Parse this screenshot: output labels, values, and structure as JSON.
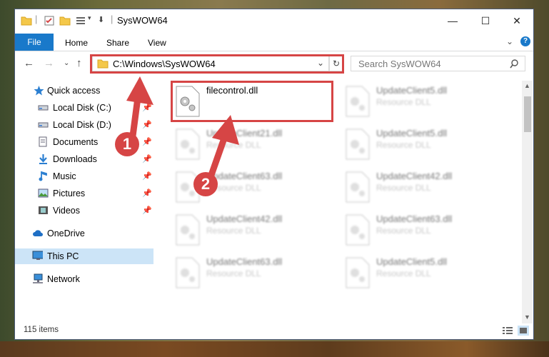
{
  "window": {
    "title": "SysWOW64",
    "minimize": "—",
    "maximize": "☐",
    "close": "✕"
  },
  "ribbon": {
    "file": "File",
    "home": "Home",
    "share": "Share",
    "view": "View",
    "help": "?"
  },
  "address": {
    "path": "C:\\Windows\\SysWOW64",
    "search_placeholder": "Search SysWOW64"
  },
  "sidebar": {
    "items": [
      {
        "label": "Quick access",
        "icon": "star-icon"
      },
      {
        "label": "Local Disk (C:)",
        "icon": "drive-icon"
      },
      {
        "label": "Local Disk (D:)",
        "icon": "drive-icon"
      },
      {
        "label": "Documents",
        "icon": "documents-icon"
      },
      {
        "label": "Downloads",
        "icon": "download-icon"
      },
      {
        "label": "Music",
        "icon": "music-icon"
      },
      {
        "label": "Pictures",
        "icon": "pictures-icon"
      },
      {
        "label": "Videos",
        "icon": "video-icon"
      },
      {
        "label": "OneDrive",
        "icon": "cloud-icon"
      },
      {
        "label": "This PC",
        "icon": "computer-icon"
      },
      {
        "label": "Network",
        "icon": "network-icon"
      }
    ]
  },
  "files": {
    "highlighted": {
      "name": "filecontrol.dll",
      "type": ""
    },
    "col1": [
      {
        "name": "UpdateClient21.dll",
        "type": "Resource DLL"
      },
      {
        "name": "UpdateClient63.dll",
        "type": "Resource DLL"
      },
      {
        "name": "UpdateClient42.dll",
        "type": "Resource DLL"
      },
      {
        "name": "UpdateClient63.dll",
        "type": "Resource DLL"
      }
    ],
    "col2": [
      {
        "name": "UpdateClient5.dll",
        "type": "Resource DLL"
      },
      {
        "name": "UpdateClient5.dll",
        "type": "Resource DLL"
      },
      {
        "name": "UpdateClient42.dll",
        "type": "Resource DLL"
      },
      {
        "name": "UpdateClient63.dll",
        "type": "Resource DLL"
      },
      {
        "name": "UpdateClient5.dll",
        "type": "Resource DLL"
      }
    ]
  },
  "status": {
    "count": "115 items"
  },
  "annotations": {
    "step1": "1",
    "step2": "2"
  },
  "colors": {
    "accent": "#1979ca",
    "highlight": "#d64545"
  }
}
